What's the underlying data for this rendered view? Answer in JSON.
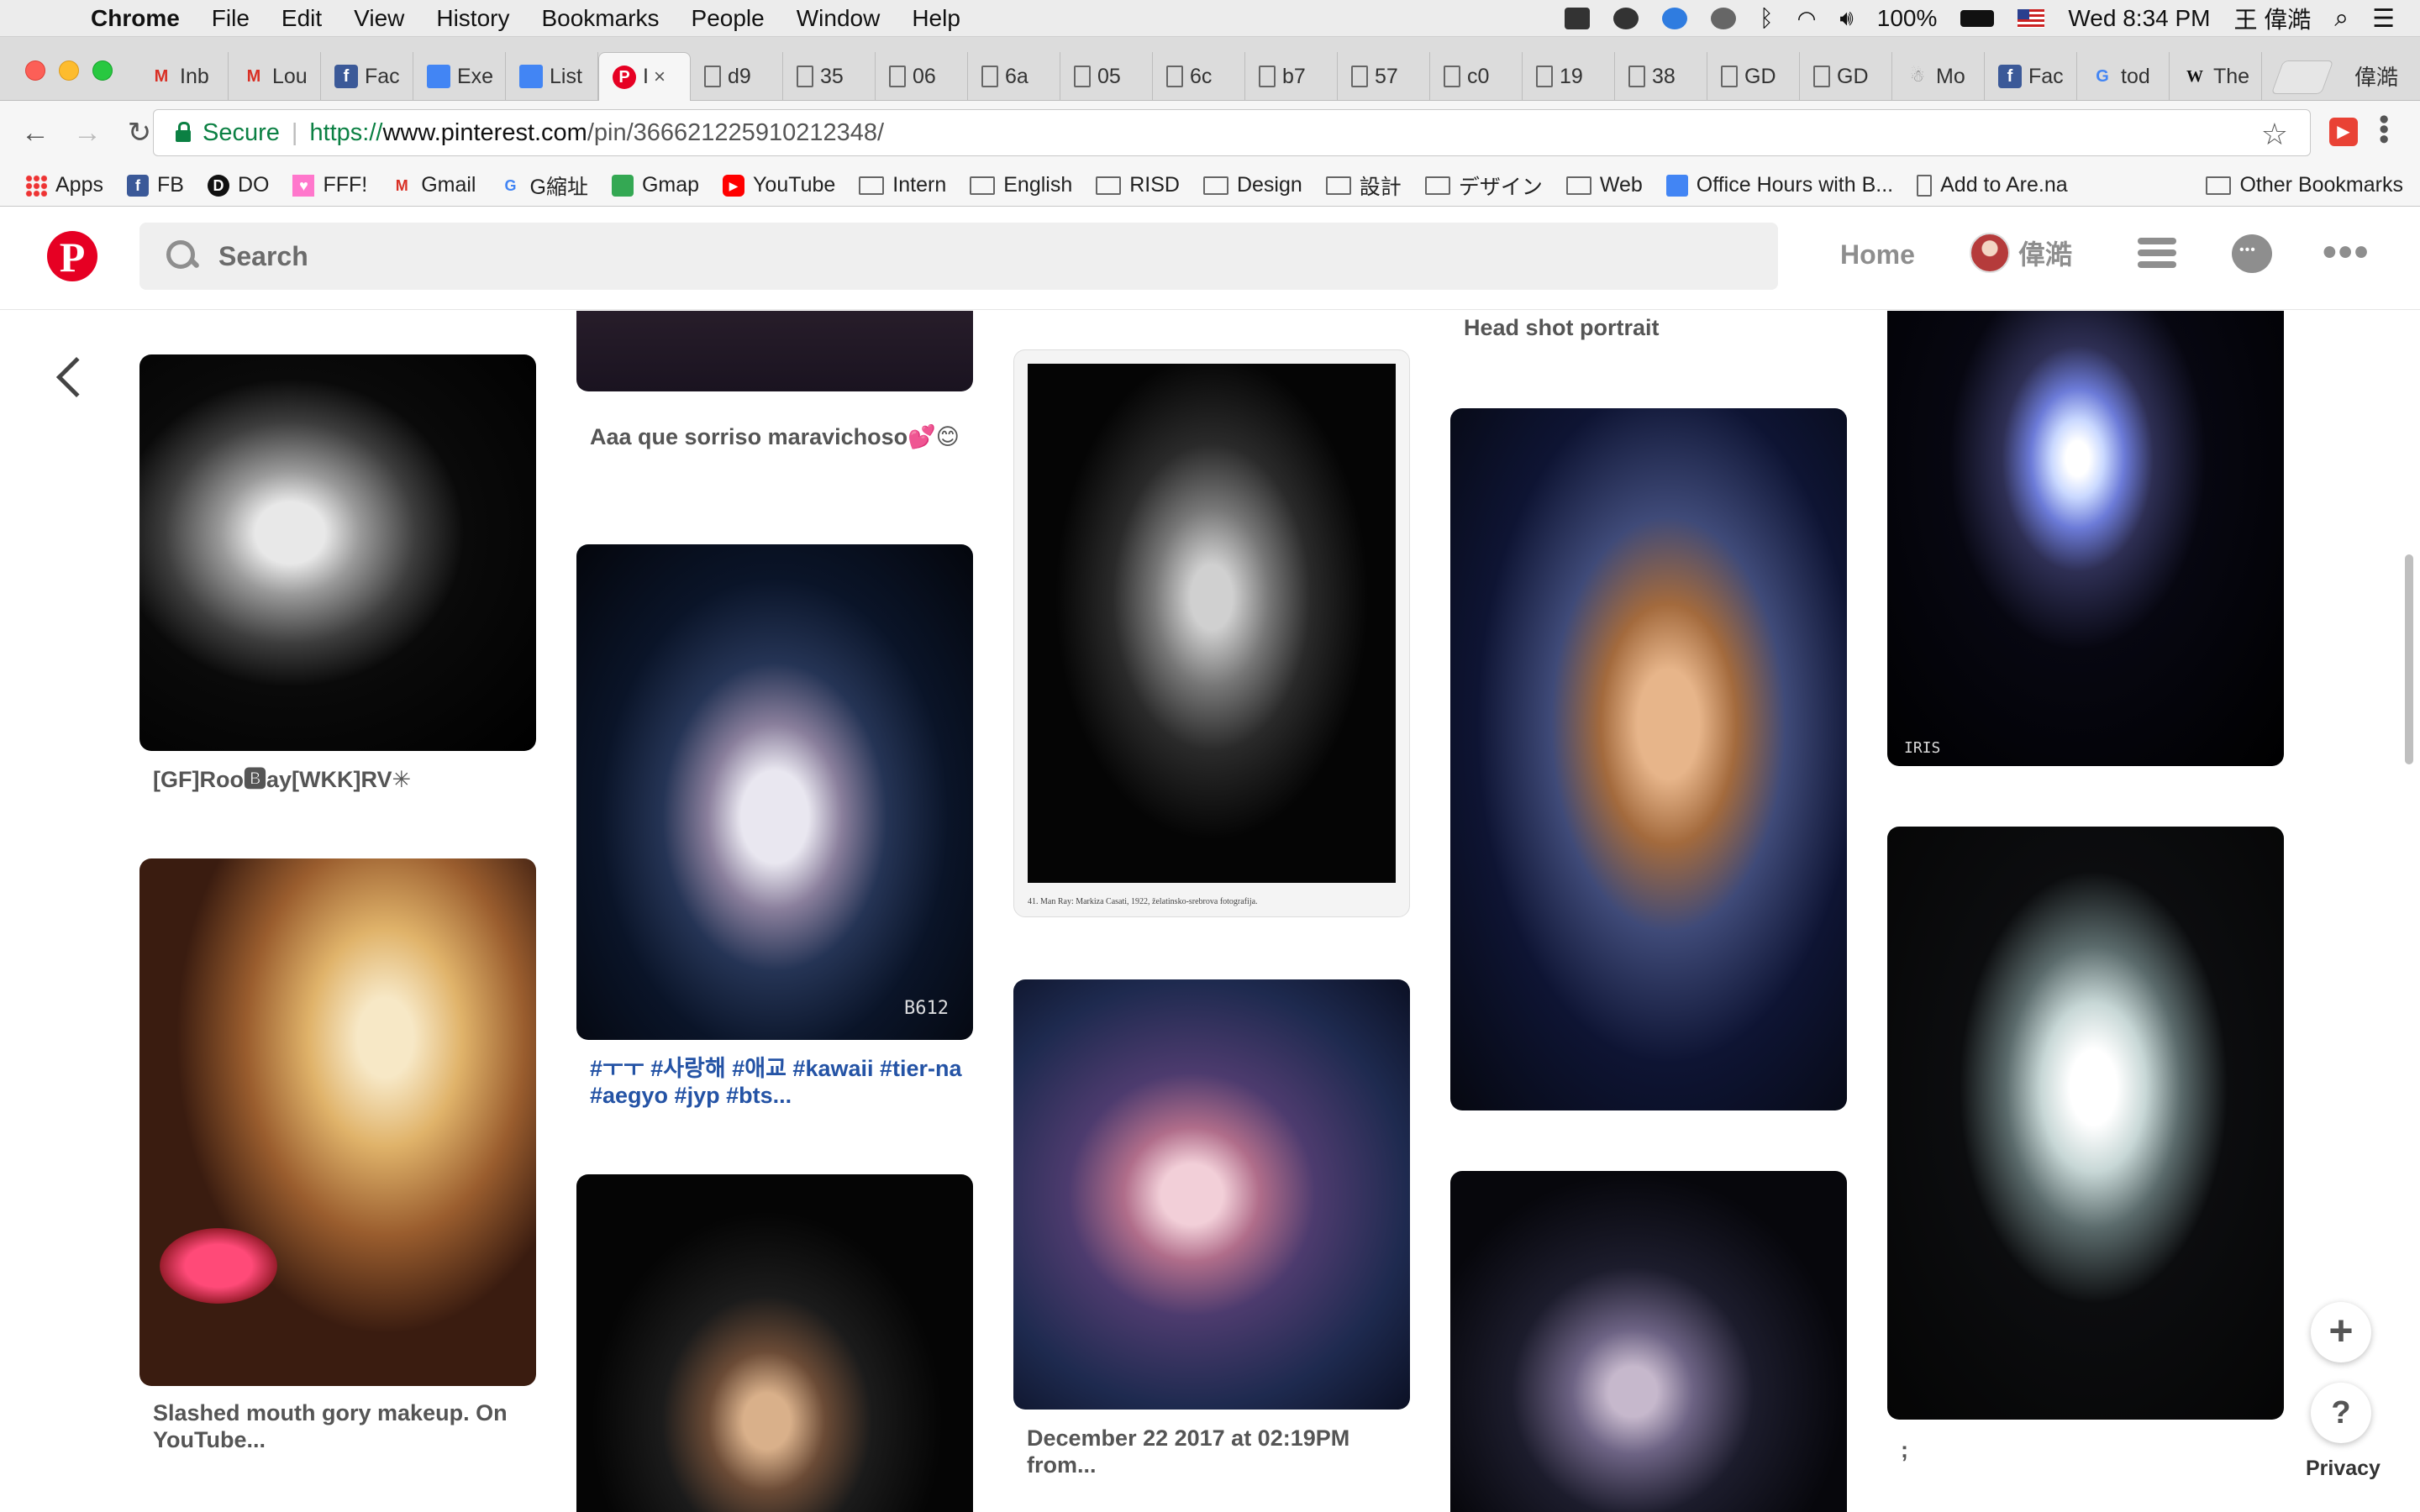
{
  "menubar": {
    "app": "Chrome",
    "menus": [
      "File",
      "Edit",
      "View",
      "History",
      "Bookmarks",
      "People",
      "Window",
      "Help"
    ],
    "battery": "100%",
    "clock": "Wed 8:34 PM",
    "user": "王 偉澔"
  },
  "tabs": [
    {
      "label": "Inb",
      "icon": "gmail-icon"
    },
    {
      "label": "Lou",
      "icon": "gmail-icon"
    },
    {
      "label": "Fac",
      "icon": "facebook-icon"
    },
    {
      "label": "Exe",
      "icon": "google-doc-icon"
    },
    {
      "label": "List",
      "icon": "google-doc-icon"
    },
    {
      "label": "I",
      "icon": "pinterest-icon",
      "active": true
    },
    {
      "label": "d9",
      "icon": "page-icon"
    },
    {
      "label": "35",
      "icon": "page-icon"
    },
    {
      "label": "06",
      "icon": "page-icon"
    },
    {
      "label": "6a",
      "icon": "page-icon"
    },
    {
      "label": "05",
      "icon": "page-icon"
    },
    {
      "label": "6c",
      "icon": "page-icon"
    },
    {
      "label": "b7",
      "icon": "page-icon"
    },
    {
      "label": "57",
      "icon": "page-icon"
    },
    {
      "label": "c0",
      "icon": "page-icon"
    },
    {
      "label": "19",
      "icon": "page-icon"
    },
    {
      "label": "38",
      "icon": "page-icon"
    },
    {
      "label": "GD",
      "icon": "page-icon"
    },
    {
      "label": "GD",
      "icon": "page-icon"
    },
    {
      "label": "Mo",
      "icon": "wiki-image-icon"
    },
    {
      "label": "Fac",
      "icon": "facebook-icon"
    },
    {
      "label": "tod",
      "icon": "google-icon"
    },
    {
      "label": "The",
      "icon": "wikipedia-icon"
    }
  ],
  "profile_name": "偉澔",
  "address": {
    "secure_label": "Secure",
    "scheme": "https://",
    "host": "www.pinterest.com",
    "path": "/pin/366621225910212348/"
  },
  "bookmarks": [
    {
      "label": "Apps",
      "icon": "apps-grid-icon"
    },
    {
      "label": "FB",
      "icon": "facebook-icon"
    },
    {
      "label": "DO",
      "icon": "digitalocean-icon"
    },
    {
      "label": "FFF!",
      "icon": "fff-icon"
    },
    {
      "label": "Gmail",
      "icon": "gmail-icon"
    },
    {
      "label": "G縮址",
      "icon": "google-icon"
    },
    {
      "label": "Gmap",
      "icon": "maps-icon"
    },
    {
      "label": "YouTube",
      "icon": "youtube-icon"
    },
    {
      "label": "Intern",
      "icon": "folder-icon"
    },
    {
      "label": "English",
      "icon": "folder-icon"
    },
    {
      "label": "RISD",
      "icon": "folder-icon"
    },
    {
      "label": "Design",
      "icon": "folder-icon"
    },
    {
      "label": "設計",
      "icon": "folder-icon"
    },
    {
      "label": "デザイン",
      "icon": "folder-icon"
    },
    {
      "label": "Web",
      "icon": "folder-icon"
    },
    {
      "label": "Office Hours with B...",
      "icon": "google-doc-icon"
    },
    {
      "label": "Add to Are.na",
      "icon": "page-icon"
    }
  ],
  "other_bookmarks": "Other Bookmarks",
  "pinterest": {
    "search_placeholder": "Search",
    "home": "Home",
    "user": "偉澔",
    "pins": [
      {
        "title": "[GF]Roo🅱ay[WKK]RV✳"
      },
      {
        "title": "Slashed mouth gory makeup. On YouTube..."
      },
      {
        "title": "Aaa que sorriso maravichoso💕😊"
      },
      {
        "title": "#ㅜㅜ #사랑해 #애교 #kawaii #tier-na #aegyo #jyp #bts..."
      },
      {
        "title": "December 22 2017 at 02:19PM from..."
      },
      {
        "title": "Head shot portrait"
      },
      {
        "title": ";"
      }
    ],
    "image_caption": "41.  Man Ray: Markiza Casati, 1922, želatinsko-srebrova fotografija.",
    "watermark_b612": "B612",
    "watermark_iris": "IRIS",
    "privacy": "Privacy"
  }
}
